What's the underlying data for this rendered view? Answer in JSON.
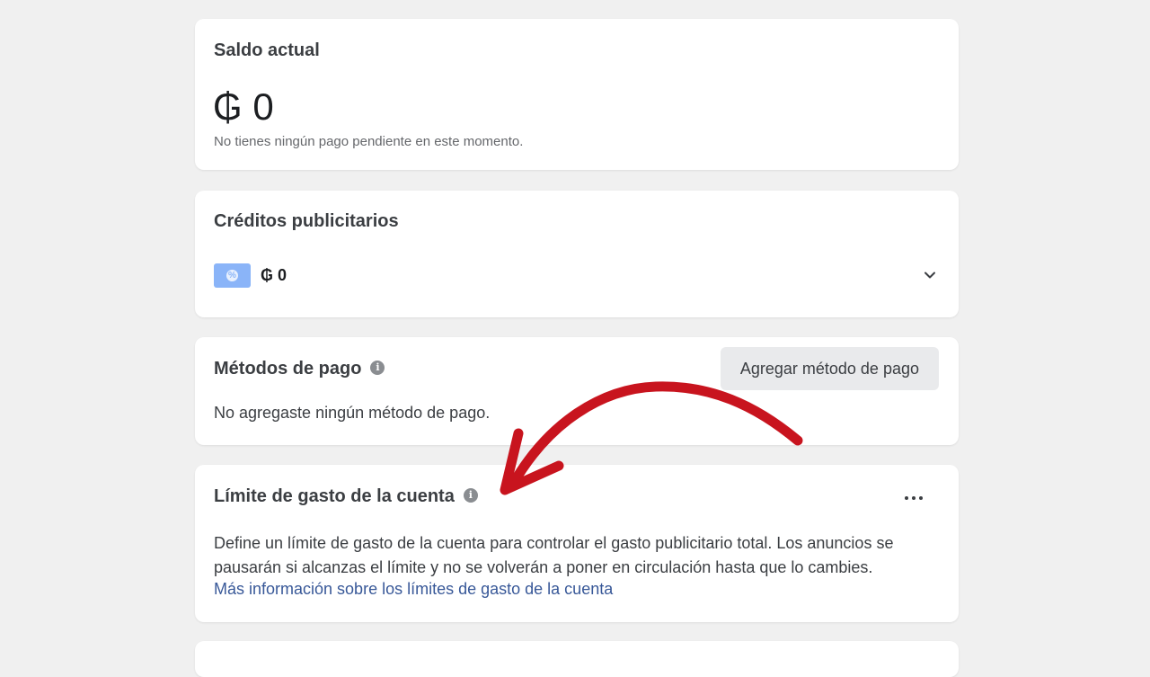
{
  "balance": {
    "title": "Saldo actual",
    "amount": "₲ 0",
    "note": "No tienes ningún pago pendiente en este momento."
  },
  "credits": {
    "title": "Créditos publicitarios",
    "amount": "₲ 0",
    "badge_icon": "percent-badge-icon",
    "expand_icon": "chevron-down-icon"
  },
  "payment_methods": {
    "title": "Métodos de pago",
    "info_icon": "info-icon",
    "add_button_label": "Agregar método de pago",
    "empty_note": "No agregaste ningún método de pago."
  },
  "spend_limit": {
    "title": "Límite de gasto de la cuenta",
    "info_icon": "info-icon",
    "more_icon": "more-options-icon",
    "description": "Define un límite de gasto de la cuenta para controlar el gasto publicitario total. Los anuncios se pausarán si alcanzas el límite y no se volverán a poner en circulación hasta que lo cambies.",
    "link_label": "Más información sobre los límites de gasto de la cuenta"
  },
  "colors": {
    "background": "#f0f0f0",
    "card": "#ffffff",
    "link": "#385898",
    "badge": "#8ab4f8",
    "annotation_arrow": "#c8141e"
  }
}
